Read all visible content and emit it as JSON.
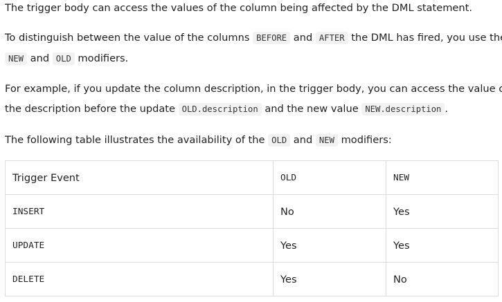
{
  "paragraphs": {
    "p1": {
      "text": "The trigger body can access the values of the column being affected by the DML statement."
    },
    "p2": {
      "t1": "To distinguish between the value of the columns",
      "c1": "BEFORE",
      "t2": "and",
      "c2": "AFTER",
      "t3": "the DML has fired, you use the",
      "c3": "NEW",
      "t4": "and",
      "c4": "OLD",
      "t5": "modifiers."
    },
    "p3": {
      "t1": "For example, if you update the column description, in the trigger body, you can access the value of",
      "t2": "the description before the update",
      "c1": "OLD.description",
      "t3": "and the new value",
      "c2": "NEW.description",
      "t4": "."
    },
    "p4": {
      "t1": "The following table illustrates the availability of the",
      "c1": "OLD",
      "t2": "and",
      "c2": "NEW",
      "t3": "modifiers:"
    }
  },
  "table": {
    "headers": [
      "Trigger Event",
      "OLD",
      "NEW"
    ],
    "rows": [
      [
        "INSERT",
        "No",
        "Yes"
      ],
      [
        "UPDATE",
        "Yes",
        "Yes"
      ],
      [
        "DELETE",
        "Yes",
        "No"
      ]
    ]
  }
}
